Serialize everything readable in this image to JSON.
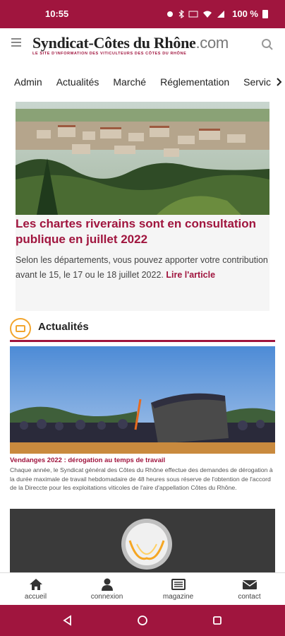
{
  "status_bar": {
    "time": "10:55",
    "battery": "100 %"
  },
  "header": {
    "logo_main": "Syndicat-Côtes du Rhône",
    "logo_suffix": ".com",
    "logo_tagline": "LE SITE D'INFORMATION DES VITICULTEURS DES CÔTES DU RHÔNE"
  },
  "nav_tabs": [
    "Admin",
    "Actualités",
    "Marché",
    "Réglementation",
    "Servic"
  ],
  "hero": {
    "title": "Les chartes riverains sont en consultation publique en juillet 2022",
    "text": "Selon les départements, vous pouvez apporter votre contribution avant le 15, le 17 ou le 18 juillet 2022.",
    "more_link": "Lire l'article"
  },
  "section": {
    "title": "Actualités"
  },
  "articles": [
    {
      "title": "Vendanges 2022 : dérogation au temps de travail",
      "excerpt": "Chaque année, le Syndicat général des Côtes du Rhône effectue des demandes de dérogation à la durée maximale de travail hebdomadaire de 48 heures sous réserve de l'obtention de l'accord de la Direccte pour les exploitations viticoles de l'aire d'appellation Côtes du Rhône."
    }
  ],
  "bottom_nav": [
    {
      "label": "accueil",
      "icon": "home-icon"
    },
    {
      "label": "connexion",
      "icon": "user-icon"
    },
    {
      "label": "magazine",
      "icon": "magazine-icon"
    },
    {
      "label": "contact",
      "icon": "mail-icon"
    }
  ],
  "colors": {
    "brand": "#a0153e",
    "accent": "#f2a52e"
  }
}
